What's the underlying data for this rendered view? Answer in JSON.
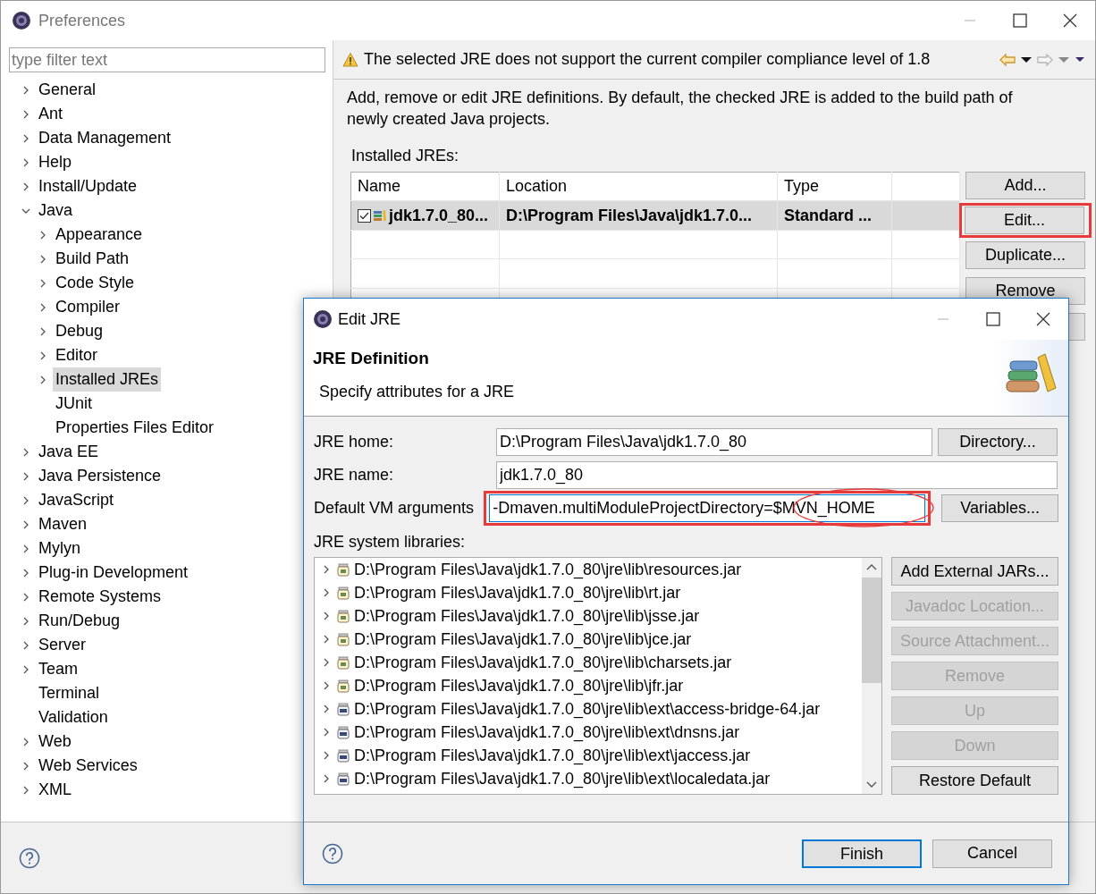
{
  "window": {
    "title": "Preferences"
  },
  "filter": {
    "placeholder": "type filter text"
  },
  "tree": [
    {
      "label": "General",
      "expanded": false,
      "selected": false
    },
    {
      "label": "Ant",
      "expanded": false,
      "selected": false
    },
    {
      "label": "Data Management",
      "expanded": false,
      "selected": false
    },
    {
      "label": "Help",
      "expanded": false,
      "selected": false
    },
    {
      "label": "Install/Update",
      "expanded": false,
      "selected": false
    },
    {
      "label": "Java",
      "expanded": true,
      "selected": false,
      "children": [
        {
          "label": "Appearance",
          "expanded": false,
          "selected": false
        },
        {
          "label": "Build Path",
          "expanded": false,
          "selected": false
        },
        {
          "label": "Code Style",
          "expanded": false,
          "selected": false
        },
        {
          "label": "Compiler",
          "expanded": false,
          "selected": false
        },
        {
          "label": "Debug",
          "expanded": false,
          "selected": false
        },
        {
          "label": "Editor",
          "expanded": false,
          "selected": false
        },
        {
          "label": "Installed JREs",
          "expanded": false,
          "selected": true
        },
        {
          "label": "JUnit",
          "selected": false
        },
        {
          "label": "Properties Files Editor",
          "selected": false
        }
      ]
    },
    {
      "label": "Java EE",
      "expanded": false,
      "selected": false
    },
    {
      "label": "Java Persistence",
      "expanded": false,
      "selected": false
    },
    {
      "label": "JavaScript",
      "expanded": false,
      "selected": false
    },
    {
      "label": "Maven",
      "expanded": false,
      "selected": false
    },
    {
      "label": "Mylyn",
      "expanded": false,
      "selected": false
    },
    {
      "label": "Plug-in Development",
      "expanded": false,
      "selected": false
    },
    {
      "label": "Remote Systems",
      "expanded": false,
      "selected": false
    },
    {
      "label": "Run/Debug",
      "expanded": false,
      "selected": false
    },
    {
      "label": "Server",
      "expanded": false,
      "selected": false
    },
    {
      "label": "Team",
      "expanded": false,
      "selected": false
    },
    {
      "label": "Terminal",
      "selected": false
    },
    {
      "label": "Validation",
      "selected": false
    },
    {
      "label": "Web",
      "expanded": false,
      "selected": false
    },
    {
      "label": "Web Services",
      "expanded": false,
      "selected": false
    },
    {
      "label": "XML",
      "expanded": false,
      "selected": false
    }
  ],
  "page": {
    "message": "The selected JRE does not support the current compiler compliance level of 1.8",
    "description": "Add, remove or edit JRE definitions. By default, the checked JRE is added to the build path of newly created Java projects.",
    "installed_label": "Installed JREs:",
    "table": {
      "columns": [
        "Name",
        "Location",
        "Type"
      ],
      "rows": [
        {
          "checked": true,
          "selected": true,
          "name": "jdk1.7.0_80...",
          "location": "D:\\Program Files\\Java\\jdk1.7.0...",
          "type": "Standard ..."
        }
      ]
    },
    "buttons": [
      {
        "label": "Add...",
        "highlighted": false
      },
      {
        "label": "Edit...",
        "highlighted": true
      },
      {
        "label": "Duplicate...",
        "highlighted": false
      },
      {
        "label": "Remove",
        "highlighted": false
      }
    ]
  },
  "dialog": {
    "title": "Edit JRE",
    "heading": "JRE Definition",
    "subtitle": "Specify attributes for a JRE",
    "fields": [
      {
        "label": "JRE home:",
        "value": "D:\\Program Files\\Java\\jdk1.7.0_80",
        "button": "Directory...",
        "highlighted": false,
        "circled": false,
        "focused": false
      },
      {
        "label": "JRE name:",
        "value": "jdk1.7.0_80",
        "highlighted": false,
        "circled": false,
        "focused": false
      },
      {
        "label": "Default VM arguments",
        "value": "-Dmaven.multiModuleProjectDirectory=$MVN_HOME",
        "button": "Variables...",
        "highlighted": true,
        "circled": true,
        "focused": true
      }
    ],
    "libraries_label": "JRE system libraries:",
    "libraries": [
      {
        "path": "D:\\Program Files\\Java\\jdk1.7.0_80\\jre\\lib\\resources.jar",
        "kind": "jar"
      },
      {
        "path": "D:\\Program Files\\Java\\jdk1.7.0_80\\jre\\lib\\rt.jar",
        "kind": "jar"
      },
      {
        "path": "D:\\Program Files\\Java\\jdk1.7.0_80\\jre\\lib\\jsse.jar",
        "kind": "jar"
      },
      {
        "path": "D:\\Program Files\\Java\\jdk1.7.0_80\\jre\\lib\\jce.jar",
        "kind": "jar"
      },
      {
        "path": "D:\\Program Files\\Java\\jdk1.7.0_80\\jre\\lib\\charsets.jar",
        "kind": "jar"
      },
      {
        "path": "D:\\Program Files\\Java\\jdk1.7.0_80\\jre\\lib\\jfr.jar",
        "kind": "jar"
      },
      {
        "path": "D:\\Program Files\\Java\\jdk1.7.0_80\\jre\\lib\\ext\\access-bridge-64.jar",
        "kind": "binary-jar"
      },
      {
        "path": "D:\\Program Files\\Java\\jdk1.7.0_80\\jre\\lib\\ext\\dnsns.jar",
        "kind": "binary-jar"
      },
      {
        "path": "D:\\Program Files\\Java\\jdk1.7.0_80\\jre\\lib\\ext\\jaccess.jar",
        "kind": "binary-jar"
      },
      {
        "path": "D:\\Program Files\\Java\\jdk1.7.0_80\\jre\\lib\\ext\\localedata.jar",
        "kind": "binary-jar"
      }
    ],
    "library_buttons": [
      {
        "label": "Add External JARs...",
        "disabled": false
      },
      {
        "label": "Javadoc Location...",
        "disabled": true
      },
      {
        "label": "Source Attachment...",
        "disabled": true
      },
      {
        "label": "Remove",
        "disabled": true
      },
      {
        "label": "Up",
        "disabled": true
      },
      {
        "label": "Down",
        "disabled": true
      },
      {
        "label": "Restore Default",
        "disabled": false
      }
    ],
    "buttons": [
      {
        "label": "Finish",
        "default": true
      },
      {
        "label": "Cancel",
        "default": false
      }
    ]
  }
}
